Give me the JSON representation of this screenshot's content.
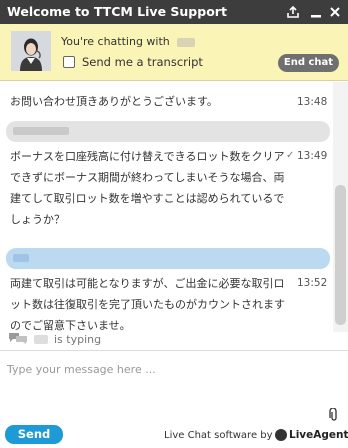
{
  "window": {
    "title": "Welcome to TTCM Live Support",
    "controls": [
      "popout-icon",
      "minimize-icon",
      "close-icon"
    ]
  },
  "agent_bar": {
    "chatting_with": "You're chatting with",
    "transcript_label": "Send me a transcript",
    "end_chat": "End chat"
  },
  "messages": [
    {
      "text": "お問い合わせ頂きありがとうございます。",
      "time": "13:48"
    },
    {
      "text": "ボーナスを口座残高に付け替えできるロット数をクリアできずにボーナス期間が終わってしまいそうな場合、両建てして取引ロット数を増やすことは認められているでしょうか？",
      "time": "13:49",
      "check": "✓"
    },
    {
      "text": "両建て取引は可能となりますが、ご出金に必要な取引ロット数は往復取引を完了頂いたものがカウントされますのでご留意下さいませ。",
      "time": "13:52"
    }
  ],
  "typing": {
    "text": "is typing"
  },
  "input": {
    "placeholder": "Type your message here ..."
  },
  "footer": {
    "send": "Send",
    "powered_by": "Live Chat software by",
    "brand": "LiveAgent"
  },
  "colors": {
    "titlebar": "#3d3d3d",
    "agent_bar": "#fbf4b7",
    "agent_band": "#e3e3e3",
    "visitor_band": "#bcd9f2",
    "send_button": "#1e9bd7"
  }
}
